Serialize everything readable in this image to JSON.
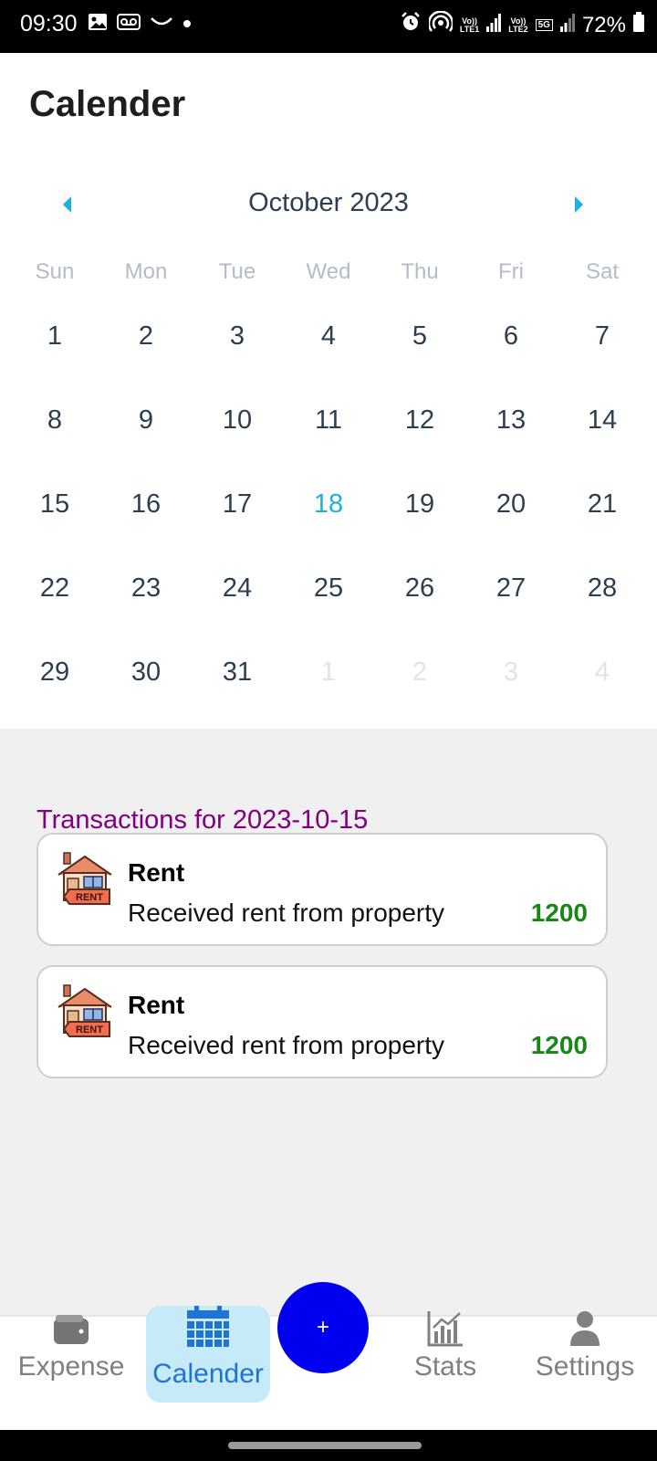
{
  "status_bar": {
    "time": "09:30",
    "battery": "72%",
    "sim1_label_top": "Vo))",
    "sim1_label_bottom": "LTE1",
    "sim2_label_top": "Vo))",
    "sim2_label_bottom": "LTE2",
    "network_badge": "5G"
  },
  "app_bar": {
    "title": "Calender"
  },
  "calendar": {
    "month_label": "October 2023",
    "weekdays": [
      "Sun",
      "Mon",
      "Tue",
      "Wed",
      "Thu",
      "Fri",
      "Sat"
    ],
    "days": [
      {
        "label": "1",
        "state": "normal"
      },
      {
        "label": "2",
        "state": "normal"
      },
      {
        "label": "3",
        "state": "normal"
      },
      {
        "label": "4",
        "state": "normal"
      },
      {
        "label": "5",
        "state": "normal"
      },
      {
        "label": "6",
        "state": "normal"
      },
      {
        "label": "7",
        "state": "normal"
      },
      {
        "label": "8",
        "state": "normal"
      },
      {
        "label": "9",
        "state": "normal"
      },
      {
        "label": "10",
        "state": "normal"
      },
      {
        "label": "11",
        "state": "normal"
      },
      {
        "label": "12",
        "state": "normal"
      },
      {
        "label": "13",
        "state": "normal"
      },
      {
        "label": "14",
        "state": "normal"
      },
      {
        "label": "15",
        "state": "normal"
      },
      {
        "label": "16",
        "state": "normal"
      },
      {
        "label": "17",
        "state": "normal"
      },
      {
        "label": "18",
        "state": "today"
      },
      {
        "label": "19",
        "state": "normal"
      },
      {
        "label": "20",
        "state": "normal"
      },
      {
        "label": "21",
        "state": "normal"
      },
      {
        "label": "22",
        "state": "normal"
      },
      {
        "label": "23",
        "state": "normal"
      },
      {
        "label": "24",
        "state": "normal"
      },
      {
        "label": "25",
        "state": "normal"
      },
      {
        "label": "26",
        "state": "normal"
      },
      {
        "label": "27",
        "state": "normal"
      },
      {
        "label": "28",
        "state": "normal"
      },
      {
        "label": "29",
        "state": "normal"
      },
      {
        "label": "30",
        "state": "normal"
      },
      {
        "label": "31",
        "state": "normal"
      },
      {
        "label": "1",
        "state": "muted"
      },
      {
        "label": "2",
        "state": "muted"
      },
      {
        "label": "3",
        "state": "muted"
      },
      {
        "label": "4",
        "state": "muted"
      }
    ]
  },
  "transactions": {
    "title": "Transactions for 2023-10-15",
    "items": [
      {
        "name": "Rent",
        "description": "Received rent from property",
        "amount": "1200",
        "icon": "house-rent-icon",
        "icon_text": "RENT"
      },
      {
        "name": "Rent",
        "description": "Received rent from property",
        "amount": "1200",
        "icon": "house-rent-icon",
        "icon_text": "RENT"
      }
    ]
  },
  "bottom_nav": {
    "items": [
      {
        "label": "Expense",
        "icon": "wallet-icon"
      },
      {
        "label": "Calender",
        "icon": "calendar-icon",
        "active": true
      },
      {
        "label": "Stats",
        "icon": "bar-chart-icon"
      },
      {
        "label": "Settings",
        "icon": "person-icon"
      }
    ],
    "fab_label": "+"
  },
  "colors": {
    "accent": "#1fb0e0",
    "title_purple": "#800080",
    "amount_green": "#178717",
    "fab_blue": "#0000f0",
    "active_nav_bg": "#c6eaf7",
    "active_nav_text": "#1f73d6"
  }
}
